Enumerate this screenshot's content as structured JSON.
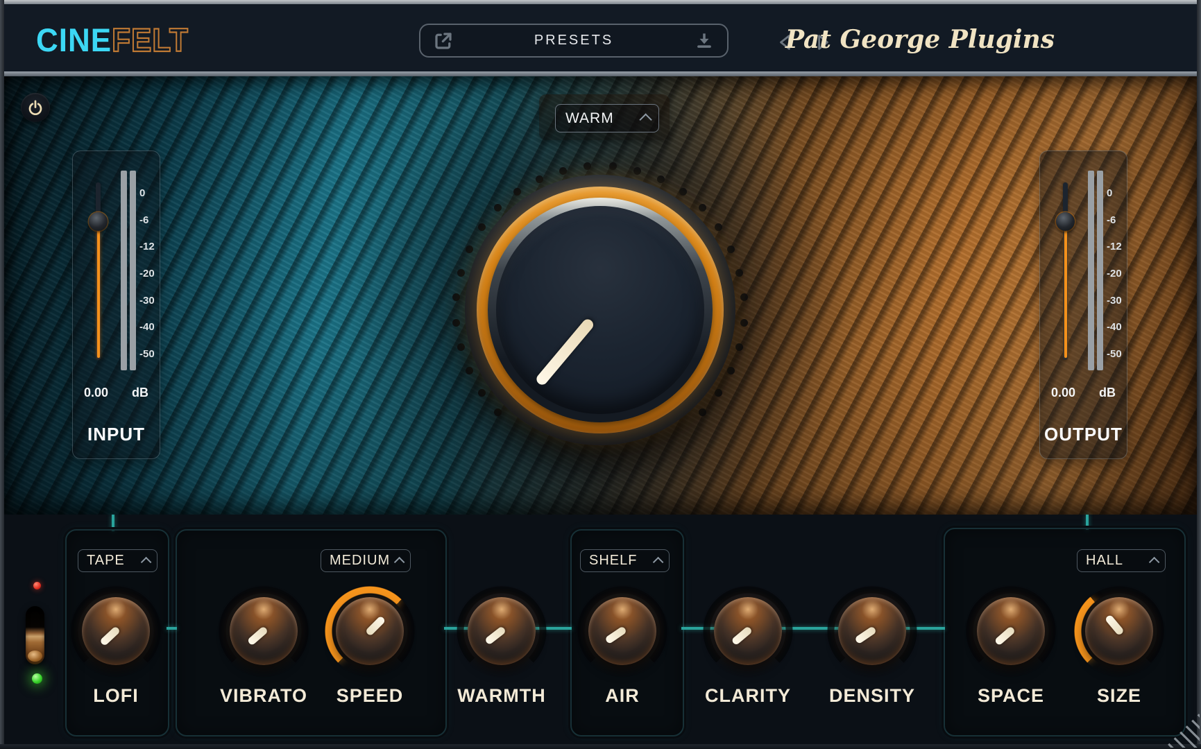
{
  "header": {
    "logo_part1": "CINE",
    "logo_part2": "FELT",
    "presets_label": "PRESETS",
    "brand": "Pat George Plugins"
  },
  "display": {
    "mode_select_value": "WARM",
    "meters": {
      "scale_ticks": [
        "0",
        "-6",
        "-12",
        "-20",
        "-30",
        "-40",
        "-50"
      ],
      "input": {
        "label": "INPUT",
        "value": "0.00",
        "unit": "dB"
      },
      "output": {
        "label": "OUTPUT",
        "value": "0.00",
        "unit": "dB"
      }
    }
  },
  "controls": {
    "lofi": {
      "label": "LOFI",
      "dropdown_value": "TAPE"
    },
    "vibrato": {
      "label": "VIBRATO"
    },
    "speed": {
      "label": "SPEED",
      "dropdown_value": "MEDIUM"
    },
    "warmth": {
      "label": "WARMTH"
    },
    "air": {
      "label": "AIR",
      "dropdown_value": "SHELF"
    },
    "clarity": {
      "label": "CLARITY"
    },
    "density": {
      "label": "DENSITY"
    },
    "space": {
      "label": "SPACE"
    },
    "size": {
      "label": "SIZE",
      "dropdown_value": "HALL"
    }
  },
  "colors": {
    "accent_teal": "#2aa39c",
    "accent_orange": "#f6951d",
    "logo_cyan": "#3cd7f4",
    "logo_orange_outline": "#c07a34",
    "brand_cream": "#f0e3c3",
    "led_red": "#e02b1e",
    "led_green": "#3ad42c"
  }
}
